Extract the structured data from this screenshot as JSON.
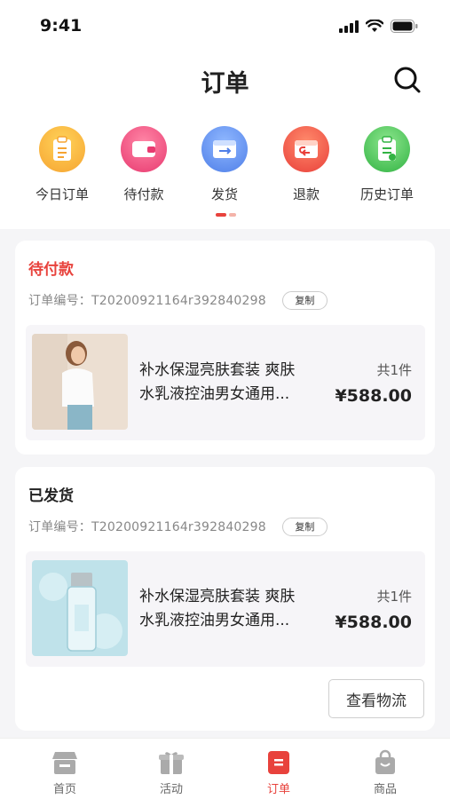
{
  "status_bar": {
    "time": "9:41"
  },
  "header": {
    "title": "订单"
  },
  "categories": [
    {
      "label": "今日订单",
      "icon": "clipboard-icon",
      "color": "#f7ad33"
    },
    {
      "label": "待付款",
      "icon": "wallet-icon",
      "color": "#ee4d7c"
    },
    {
      "label": "发货",
      "icon": "shipping-icon",
      "color": "#5b8df0"
    },
    {
      "label": "退款",
      "icon": "refund-icon",
      "color": "#ef5440"
    },
    {
      "label": "历史订单",
      "icon": "history-icon",
      "color": "#3fc04f"
    }
  ],
  "colors": {
    "accent": "#e8423c",
    "indicator_light": "#f4b3a9"
  },
  "orders": [
    {
      "status": "待付款",
      "status_color": "#e8423c",
      "order_label": "订单编号：T20200921164r392840298",
      "copy_label": "复制",
      "product": {
        "name_line1": "补水保湿亮肤套装 爽肤",
        "name_line2": "水乳液控油男女通用...",
        "count": "共1件",
        "price": "¥588.00"
      }
    },
    {
      "status": "已发货",
      "status_color": "#222222",
      "order_label": "订单编号：T20200921164r392840298",
      "copy_label": "复制",
      "product": {
        "name_line1": "补水保湿亮肤套装 爽肤",
        "name_line2": "水乳液控油男女通用...",
        "count": "共1件",
        "price": "¥588.00"
      },
      "action_label": "查看物流"
    }
  ],
  "tabbar": [
    {
      "label": "首页",
      "icon": "home-icon",
      "active": false
    },
    {
      "label": "活动",
      "icon": "activity-icon",
      "active": false
    },
    {
      "label": "订单",
      "icon": "order-icon",
      "active": true
    },
    {
      "label": "商品",
      "icon": "shopping-bag-icon",
      "active": false
    }
  ]
}
